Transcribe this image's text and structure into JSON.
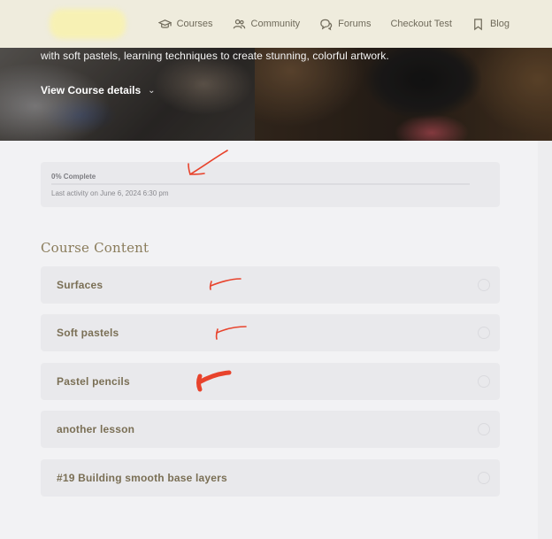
{
  "header": {
    "nav": [
      {
        "label": "Courses",
        "icon": "graduation-cap-icon"
      },
      {
        "label": "Community",
        "icon": "people-icon"
      },
      {
        "label": "Forums",
        "icon": "chat-bubbles-icon"
      },
      {
        "label": "Checkout Test",
        "icon": ""
      },
      {
        "label": "Blog",
        "icon": "bookmark-icon"
      }
    ]
  },
  "hero": {
    "description": "with soft pastels, learning techniques to create stunning, colorful artwork.",
    "view_details": "View Course details",
    "chevron": "⌄"
  },
  "progress": {
    "label": "0% Complete",
    "percent": 0,
    "last_activity": "Last activity on June 6, 2024 6:30 pm"
  },
  "course": {
    "title": "Course Content",
    "lessons": [
      {
        "title": "Surfaces",
        "completed": false
      },
      {
        "title": "Soft pastels",
        "completed": false
      },
      {
        "title": "Pastel pencils",
        "completed": false
      },
      {
        "title": "another lesson",
        "completed": false
      },
      {
        "title": "#19 Building smooth base layers",
        "completed": false
      }
    ]
  },
  "colors": {
    "header_bg": "#efecdd",
    "accent_text": "#8a7c5b",
    "lesson_bg": "#e9e9ec",
    "annotation_red": "#e8432c"
  }
}
